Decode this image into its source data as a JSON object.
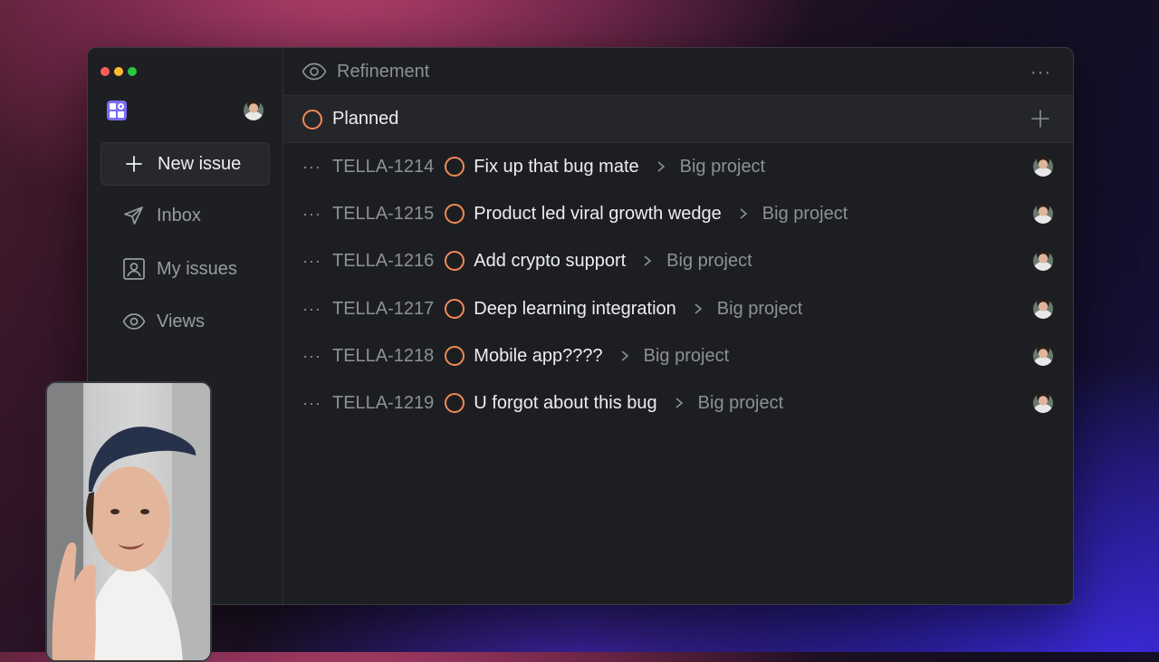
{
  "sidebar": {
    "new_issue_label": "New issue",
    "items": [
      {
        "label": "Inbox",
        "icon": "send-icon"
      },
      {
        "label": "My issues",
        "icon": "user-square-icon"
      },
      {
        "label": "Views",
        "icon": "eye-icon"
      }
    ]
  },
  "header": {
    "title": "Refinement",
    "icon": "eye-icon",
    "more": "···"
  },
  "group": {
    "label": "Planned",
    "status_color": "#ef8a55"
  },
  "issues": [
    {
      "id": "TELLA-1214",
      "title": "Fix up that bug mate",
      "project": "Big project"
    },
    {
      "id": "TELLA-1215",
      "title": "Product led viral growth wedge",
      "project": "Big project"
    },
    {
      "id": "TELLA-1216",
      "title": "Add crypto support",
      "project": "Big project"
    },
    {
      "id": "TELLA-1217",
      "title": "Deep learning integration",
      "project": "Big project"
    },
    {
      "id": "TELLA-1218",
      "title": "Mobile app????",
      "project": "Big project"
    },
    {
      "id": "TELLA-1219",
      "title": "U forgot about this bug",
      "project": "Big project"
    }
  ],
  "row_dots": "···"
}
